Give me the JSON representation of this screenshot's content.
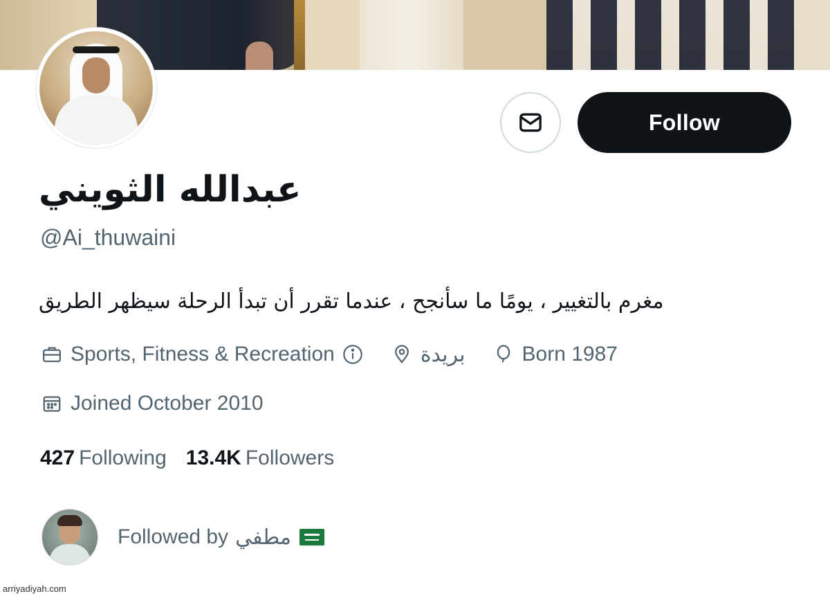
{
  "profile": {
    "display_name": "عبدالله الثويني",
    "handle": "@Ai_thuwaini",
    "bio": "مغرم بالتغيير ، يومًا ما سأنجح ، عندما تقرر أن تبدأ الرحلة سيظهر الطريق"
  },
  "actions": {
    "follow_label": "Follow",
    "message_icon": "envelope-icon"
  },
  "meta": {
    "category": "Sports, Fitness & Recreation",
    "location": "بريدة",
    "birth": "Born 1987",
    "joined": "Joined October 2010"
  },
  "stats": {
    "following_count": "427",
    "following_label": "Following",
    "followers_count": "13.4K",
    "followers_label": "Followers"
  },
  "followed_by": {
    "prefix": "Followed by",
    "name": "مطفي",
    "flag": "saudi-flag"
  },
  "watermark": "arriyadiyah.com",
  "colors": {
    "primary_text": "#0f1419",
    "secondary_text": "#536471",
    "button_dark": "#0f1419",
    "border": "#cfd9de"
  }
}
